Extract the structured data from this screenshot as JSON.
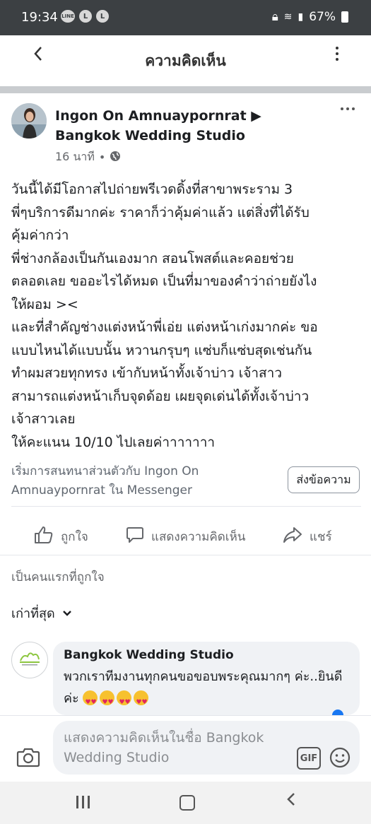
{
  "status_bar": {
    "time": "19:34",
    "badges": [
      "LINE",
      "L",
      "L"
    ],
    "battery": "67%"
  },
  "header": {
    "title": "ความคิดเห็น"
  },
  "post": {
    "author": "Ingon On Amnuaypornrat ▶ Bangkok Wedding Studio",
    "time": "16 นาที",
    "body_lines": [
      "วันนี้ได้มีโอกาสไปถ่ายพรีเวดดิ้งที่สาขาพระราม 3",
      "พี่ๆบริการดีมากค่ะ ราคาก็ว่าคุ้มค่าแล้ว แต่สิ่งที่ได้รับ",
      "คุ้มค่ากว่า",
      "พี่ช่างกล้องเป็นกันเองมาก สอนโพสต์และคอยช่วย",
      "ตลอดเลย ขออะไรได้หมด เป็นที่มาของคำว่าถ่ายยังไง",
      "ให้ผอม ><",
      "และที่สำคัญช่างแต่งหน้าพี่เอ่ย แต่งหน้าเก่งมากค่ะ ขอ",
      "แบบไหนได้แบบนั้น หวานกรุบๆ แซ่บก็แซ่บสุดเช่นกัน",
      "ทำผมสวยทุกทรง เข้ากับหน้าทั้งเจ้าบ่าว เจ้าสาว",
      "สามารถแต่งหน้าเก็บจุดด้อย เผยจุดเด่นได้ทั้งเจ้าบ่าว",
      "เจ้าสาวเลย",
      "ให้คะแนน 10/10 ไปเลยค่าาาาาาา"
    ],
    "messenger_prompt": "เริ่มการสนทนาส่วนตัวกับ Ingon On Amnuaypornrat ใน Messenger",
    "messenger_button": "ส่งข้อความ",
    "actions": {
      "like": "ถูกใจ",
      "comment": "แสดงความคิดเห็น",
      "share": "แชร์"
    },
    "first_like": "เป็นคนแรกที่ถูกใจ",
    "sort": "เก่าที่สุด"
  },
  "comment": {
    "author": "Bangkok Wedding Studio",
    "text": "พวกเราทีมงานทุกคนขอขอบพระคุณมากๆ ค่ะ..ยินดีค่ะ",
    "emoji": [
      "heart-eyes",
      "heart-eyes",
      "heart-eyes",
      "heart-eyes"
    ]
  },
  "composer": {
    "placeholder": "แสดงความคิดเห็นในชื่อ Bangkok Wedding Studio",
    "gif": "GIF"
  },
  "colors": {
    "status_bar": "#3c4043",
    "bubble": "#f0f2f5",
    "accent": "#1877f2"
  }
}
